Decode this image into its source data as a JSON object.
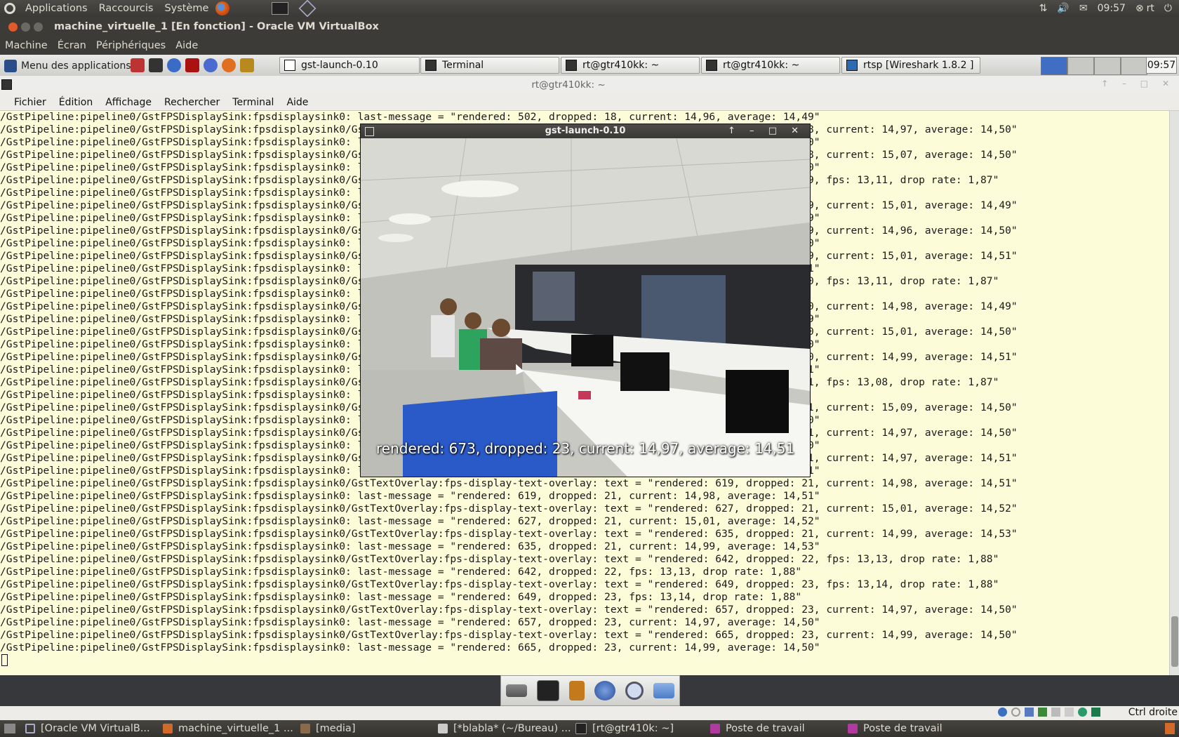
{
  "host_panel": {
    "menus": [
      "Applications",
      "Raccourcis",
      "Système"
    ],
    "clock": "09:57",
    "user": "rt",
    "icons": [
      "ubuntu-logo-icon",
      "firefox-icon",
      "terminal-icon",
      "virtualbox-icon",
      "network-icon",
      "volume-icon",
      "mail-icon",
      "user-icon",
      "power-icon"
    ]
  },
  "vbox": {
    "title": "machine_virtuelle_1 [En fonction] - Oracle VM VirtualBox",
    "menus": [
      "Machine",
      "Écran",
      "Périphériques",
      "Aide"
    ],
    "status_label": "Ctrl droite"
  },
  "guest_taskbar": {
    "app_menu": "Menu des applications",
    "clock": "09:57",
    "tasks": [
      {
        "label": "gst-launch-0.10"
      },
      {
        "label": "Terminal"
      },
      {
        "label": "rt@gtr410kk: ~"
      },
      {
        "label": "rt@gtr410kk: ~"
      },
      {
        "label": "rtsp  [Wireshark 1.8.2 ]"
      }
    ]
  },
  "terminal": {
    "title": "rt@gtr410kk: ~",
    "menus": [
      "Fichier",
      "Édition",
      "Affichage",
      "Rechercher",
      "Terminal",
      "Aide"
    ],
    "lines": [
      "/GstPipeline:pipeline0/GstFPSDisplaySink:fpsdisplaysink0: last-message = \"rendered: 502, dropped: 18, current: 14,96, average: 14,49\"",
      "/GstPipeline:pipeline0/GstFPSDisplaySink:fpsdisplaysink0/GstTextOverlay:fps-display-text-overlay: text = \"rendered: 510, dropped: 18, current: 14,97, average: 14,50\"",
      "/GstPipeline:pipeline0/GstFPSDisplaySink:fpsdisplaysink0: last-message = \"rendered: 510, dropped: 18, current: 14,97, average: 14,50\"",
      "/GstPipeline:pipeline0/GstFPSDisplaySink:fpsdisplaysink0/GstTextOverlay:fps-display-text-overlay: text = \"rendered: 518, dropped: 18, current: 15,07, average: 14,50\"",
      "/GstPipeline:pipeline0/GstFPSDisplaySink:fpsdisplaysink0: last-message = \"rendered: 518, dropped: 18, current: 15,07, average: 14,50\"",
      "/GstPipeline:pipeline0/GstFPSDisplaySink:fpsdisplaysink0/GstTextOverlay:fps-display-text-overlay: text = \"rendered: 525, dropped: 19, fps: 13,11, drop rate: 1,87\"",
      "/GstPipeline:pipeline0/GstFPSDisplaySink:fpsdisplaysink0: last-message = \"rendered: 525, dropped: 19, fps: 13,11, drop rate: 1,87\"",
      "/GstPipeline:pipeline0/GstFPSDisplaySink:fpsdisplaysink0/GstTextOverlay:fps-display-text-overlay: text = \"rendered: 532, dropped: 19, current: 15,01, average: 14,49\"",
      "/GstPipeline:pipeline0/GstFPSDisplaySink:fpsdisplaysink0: last-message = \"rendered: 532, dropped: 19, current: 15,01, average: 14,49\"",
      "/GstPipeline:pipeline0/GstFPSDisplaySink:fpsdisplaysink0/GstTextOverlay:fps-display-text-overlay: text = \"rendered: 540, dropped: 19, current: 14,96, average: 14,50\"",
      "/GstPipeline:pipeline0/GstFPSDisplaySink:fpsdisplaysink0: last-message = \"rendered: 540, dropped: 19, current: 14,96, average: 14,50\"",
      "/GstPipeline:pipeline0/GstFPSDisplaySink:fpsdisplaysink0/GstTextOverlay:fps-display-text-overlay: text = \"rendered: 548, dropped: 19, current: 15,01, average: 14,51\"",
      "/GstPipeline:pipeline0/GstFPSDisplaySink:fpsdisplaysink0: last-message = \"rendered: 548, dropped: 19, current: 15,01, average: 14,51\"",
      "/GstPipeline:pipeline0/GstFPSDisplaySink:fpsdisplaysink0/GstTextOverlay:fps-display-text-overlay: text = \"rendered: 555, dropped: 20, fps: 13,11, drop rate: 1,87\"",
      "/GstPipeline:pipeline0/GstFPSDisplaySink:fpsdisplaysink0: last-message = \"rendered: 555, dropped: 20, fps: 13,11, drop rate: 1,87\"",
      "/GstPipeline:pipeline0/GstFPSDisplaySink:fpsdisplaysink0/GstTextOverlay:fps-display-text-overlay: text = \"rendered: 562, dropped: 20, current: 14,98, average: 14,49\"",
      "/GstPipeline:pipeline0/GstFPSDisplaySink:fpsdisplaysink0: last-message = \"rendered: 562, dropped: 20, current: 14,98, average: 14,49\"",
      "/GstPipeline:pipeline0/GstFPSDisplaySink:fpsdisplaysink0/GstTextOverlay:fps-display-text-overlay: text = \"rendered: 570, dropped: 20, current: 15,01, average: 14,50\"",
      "/GstPipeline:pipeline0/GstFPSDisplaySink:fpsdisplaysink0: last-message = \"rendered: 570, dropped: 20, current: 15,01, average: 14,50\"",
      "/GstPipeline:pipeline0/GstFPSDisplaySink:fpsdisplaysink0/GstTextOverlay:fps-display-text-overlay: text = \"rendered: 578, dropped: 20, current: 14,99, average: 14,51\"",
      "/GstPipeline:pipeline0/GstFPSDisplaySink:fpsdisplaysink0: last-message = \"rendered: 578, dropped: 20, current: 14,99, average: 14,51\"",
      "/GstPipeline:pipeline0/GstFPSDisplaySink:fpsdisplaysink0/GstTextOverlay:fps-display-text-overlay: text = \"rendered: 585, dropped: 21, fps: 13,08, drop rate: 1,87\"",
      "/GstPipeline:pipeline0/GstFPSDisplaySink:fpsdisplaysink0: last-message = \"rendered: 585, dropped: 21, fps: 13,08, drop rate: 1,87\"",
      "/GstPipeline:pipeline0/GstFPSDisplaySink:fpsdisplaysink0/GstTextOverlay:fps-display-text-overlay: text = \"rendered: 593, dropped: 21, current: 15,09, average: 14,50\"",
      "/GstPipeline:pipeline0/GstFPSDisplaySink:fpsdisplaysink0: last-message = \"rendered: 593, dropped: 21, current: 15,09, average: 14,50\"",
      "/GstPipeline:pipeline0/GstFPSDisplaySink:fpsdisplaysink0/GstTextOverlay:fps-display-text-overlay: text = \"rendered: 601, dropped: 21, current: 14,97, average: 14,50\"",
      "/GstPipeline:pipeline0/GstFPSDisplaySink:fpsdisplaysink0: last-message = \"rendered: 601, dropped: 21, current: 14,97, average: 14,50\"",
      "/GstPipeline:pipeline0/GstFPSDisplaySink:fpsdisplaysink0/GstTextOverlay:fps-display-text-overlay: text = \"rendered: 611, dropped: 21, current: 14,97, average: 14,51\"",
      "/GstPipeline:pipeline0/GstFPSDisplaySink:fpsdisplaysink0: last-message = \"rendered: 611, dropped: 21, current: 14,97, average: 14,51\"",
      "/GstPipeline:pipeline0/GstFPSDisplaySink:fpsdisplaysink0/GstTextOverlay:fps-display-text-overlay: text = \"rendered: 619, dropped: 21, current: 14,98, average: 14,51\"",
      "/GstPipeline:pipeline0/GstFPSDisplaySink:fpsdisplaysink0: last-message = \"rendered: 619, dropped: 21, current: 14,98, average: 14,51\"",
      "/GstPipeline:pipeline0/GstFPSDisplaySink:fpsdisplaysink0/GstTextOverlay:fps-display-text-overlay: text = \"rendered: 627, dropped: 21, current: 15,01, average: 14,52\"",
      "/GstPipeline:pipeline0/GstFPSDisplaySink:fpsdisplaysink0: last-message = \"rendered: 627, dropped: 21, current: 15,01, average: 14,52\"",
      "/GstPipeline:pipeline0/GstFPSDisplaySink:fpsdisplaysink0/GstTextOverlay:fps-display-text-overlay: text = \"rendered: 635, dropped: 21, current: 14,99, average: 14,53\"",
      "/GstPipeline:pipeline0/GstFPSDisplaySink:fpsdisplaysink0: last-message = \"rendered: 635, dropped: 21, current: 14,99, average: 14,53\"",
      "/GstPipeline:pipeline0/GstFPSDisplaySink:fpsdisplaysink0/GstTextOverlay:fps-display-text-overlay: text = \"rendered: 642, dropped: 22, fps: 13,13, drop rate: 1,88\"",
      "/GstPipeline:pipeline0/GstFPSDisplaySink:fpsdisplaysink0: last-message = \"rendered: 642, dropped: 22, fps: 13,13, drop rate: 1,88\"",
      "/GstPipeline:pipeline0/GstFPSDisplaySink:fpsdisplaysink0/GstTextOverlay:fps-display-text-overlay: text = \"rendered: 649, dropped: 23, fps: 13,14, drop rate: 1,88\"",
      "/GstPipeline:pipeline0/GstFPSDisplaySink:fpsdisplaysink0: last-message = \"rendered: 649, dropped: 23, fps: 13,14, drop rate: 1,88\"",
      "/GstPipeline:pipeline0/GstFPSDisplaySink:fpsdisplaysink0/GstTextOverlay:fps-display-text-overlay: text = \"rendered: 657, dropped: 23, current: 14,97, average: 14,50\"",
      "/GstPipeline:pipeline0/GstFPSDisplaySink:fpsdisplaysink0: last-message = \"rendered: 657, dropped: 23, current: 14,97, average: 14,50\"",
      "/GstPipeline:pipeline0/GstFPSDisplaySink:fpsdisplaysink0/GstTextOverlay:fps-display-text-overlay: text = \"rendered: 665, dropped: 23, current: 14,99, average: 14,50\"",
      "/GstPipeline:pipeline0/GstFPSDisplaySink:fpsdisplaysink0: last-message = \"rendered: 665, dropped: 23, current: 14,99, average: 14,50\""
    ]
  },
  "video_window": {
    "title": "gst-launch-0.10",
    "overlay_text": "rendered: 673, dropped: 23, current: 14,97, average: 14,51"
  },
  "guest_dock": {
    "icons": [
      "drive-icon",
      "terminal-icon",
      "notes-icon",
      "globe-icon",
      "search-icon",
      "folder-icon"
    ]
  },
  "host_taskbar": {
    "tasks": [
      {
        "label": "[Oracle VM VirtualB..."
      },
      {
        "label": "machine_virtuelle_1 ..."
      },
      {
        "label": "[media]"
      },
      {
        "label": "[*blabla* (~/Bureau) ..."
      },
      {
        "label": "[rt@gtr410k: ~]"
      },
      {
        "label": "Poste de travail"
      },
      {
        "label": "Poste de travail"
      }
    ]
  }
}
